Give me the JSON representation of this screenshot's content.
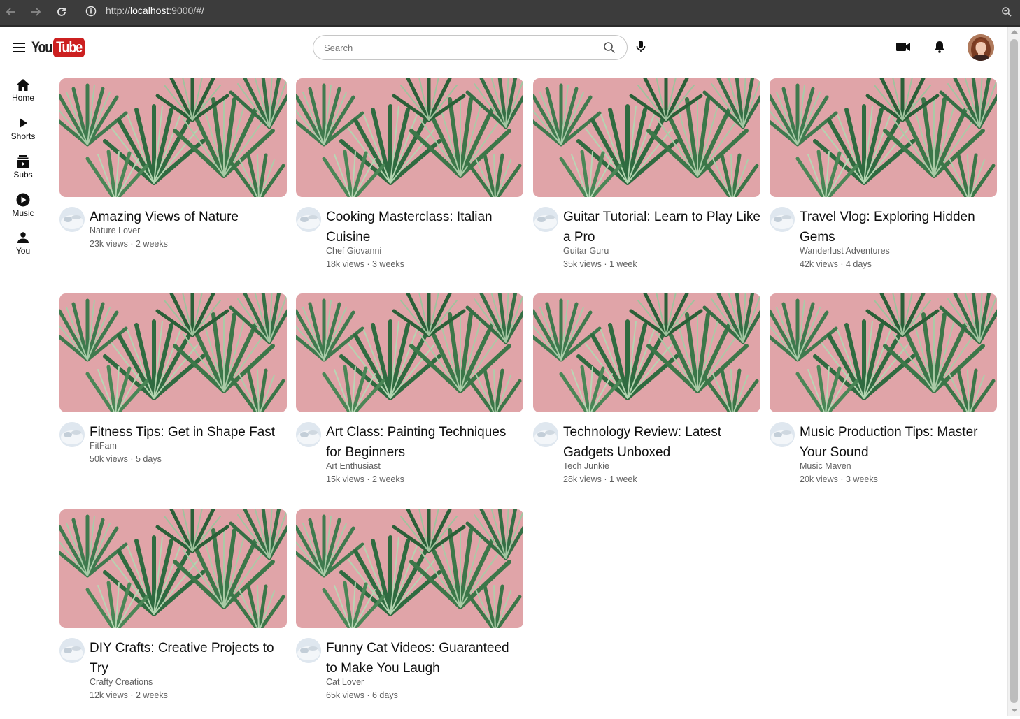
{
  "browser": {
    "url_prefix": "http://",
    "url_host": "localhost",
    "url_rest": ":9000/#/"
  },
  "header": {
    "logo_you": "You",
    "logo_tube": "Tube",
    "search_placeholder": "Search"
  },
  "sidebar": {
    "items": [
      {
        "label": "Home",
        "icon": "home-icon"
      },
      {
        "label": "Shorts",
        "icon": "play-icon"
      },
      {
        "label": "Subs",
        "icon": "subscriptions-icon"
      },
      {
        "label": "Music",
        "icon": "music-icon"
      },
      {
        "label": "You",
        "icon": "person-icon"
      }
    ]
  },
  "videos": [
    {
      "title": "Amazing Views of Nature",
      "channel": "Nature Lover",
      "stats": "23k views · 2 weeks"
    },
    {
      "title": "Cooking Masterclass: Italian Cuisine",
      "channel": "Chef Giovanni",
      "stats": "18k views · 3 weeks"
    },
    {
      "title": "Guitar Tutorial: Learn to Play Like a Pro",
      "channel": "Guitar Guru",
      "stats": "35k views · 1 week"
    },
    {
      "title": "Travel Vlog: Exploring Hidden Gems",
      "channel": "Wanderlust Adventures",
      "stats": "42k views · 4 days"
    },
    {
      "title": "Fitness Tips: Get in Shape Fast",
      "channel": "FitFam",
      "stats": "50k views · 5 days"
    },
    {
      "title": "Art Class: Painting Techniques for Beginners",
      "channel": "Art Enthusiast",
      "stats": "15k views · 2 weeks"
    },
    {
      "title": "Technology Review: Latest Gadgets Unboxed",
      "channel": "Tech Junkie",
      "stats": "28k views · 1 week"
    },
    {
      "title": "Music Production Tips: Master Your Sound",
      "channel": "Music Maven",
      "stats": "20k views · 3 weeks"
    },
    {
      "title": "DIY Crafts: Creative Projects to Try",
      "channel": "Crafty Creations",
      "stats": "12k views · 2 weeks"
    },
    {
      "title": "Funny Cat Videos: Guaranteed to Make You Laugh",
      "channel": "Cat Lover",
      "stats": "65k views · 6 days"
    }
  ]
}
